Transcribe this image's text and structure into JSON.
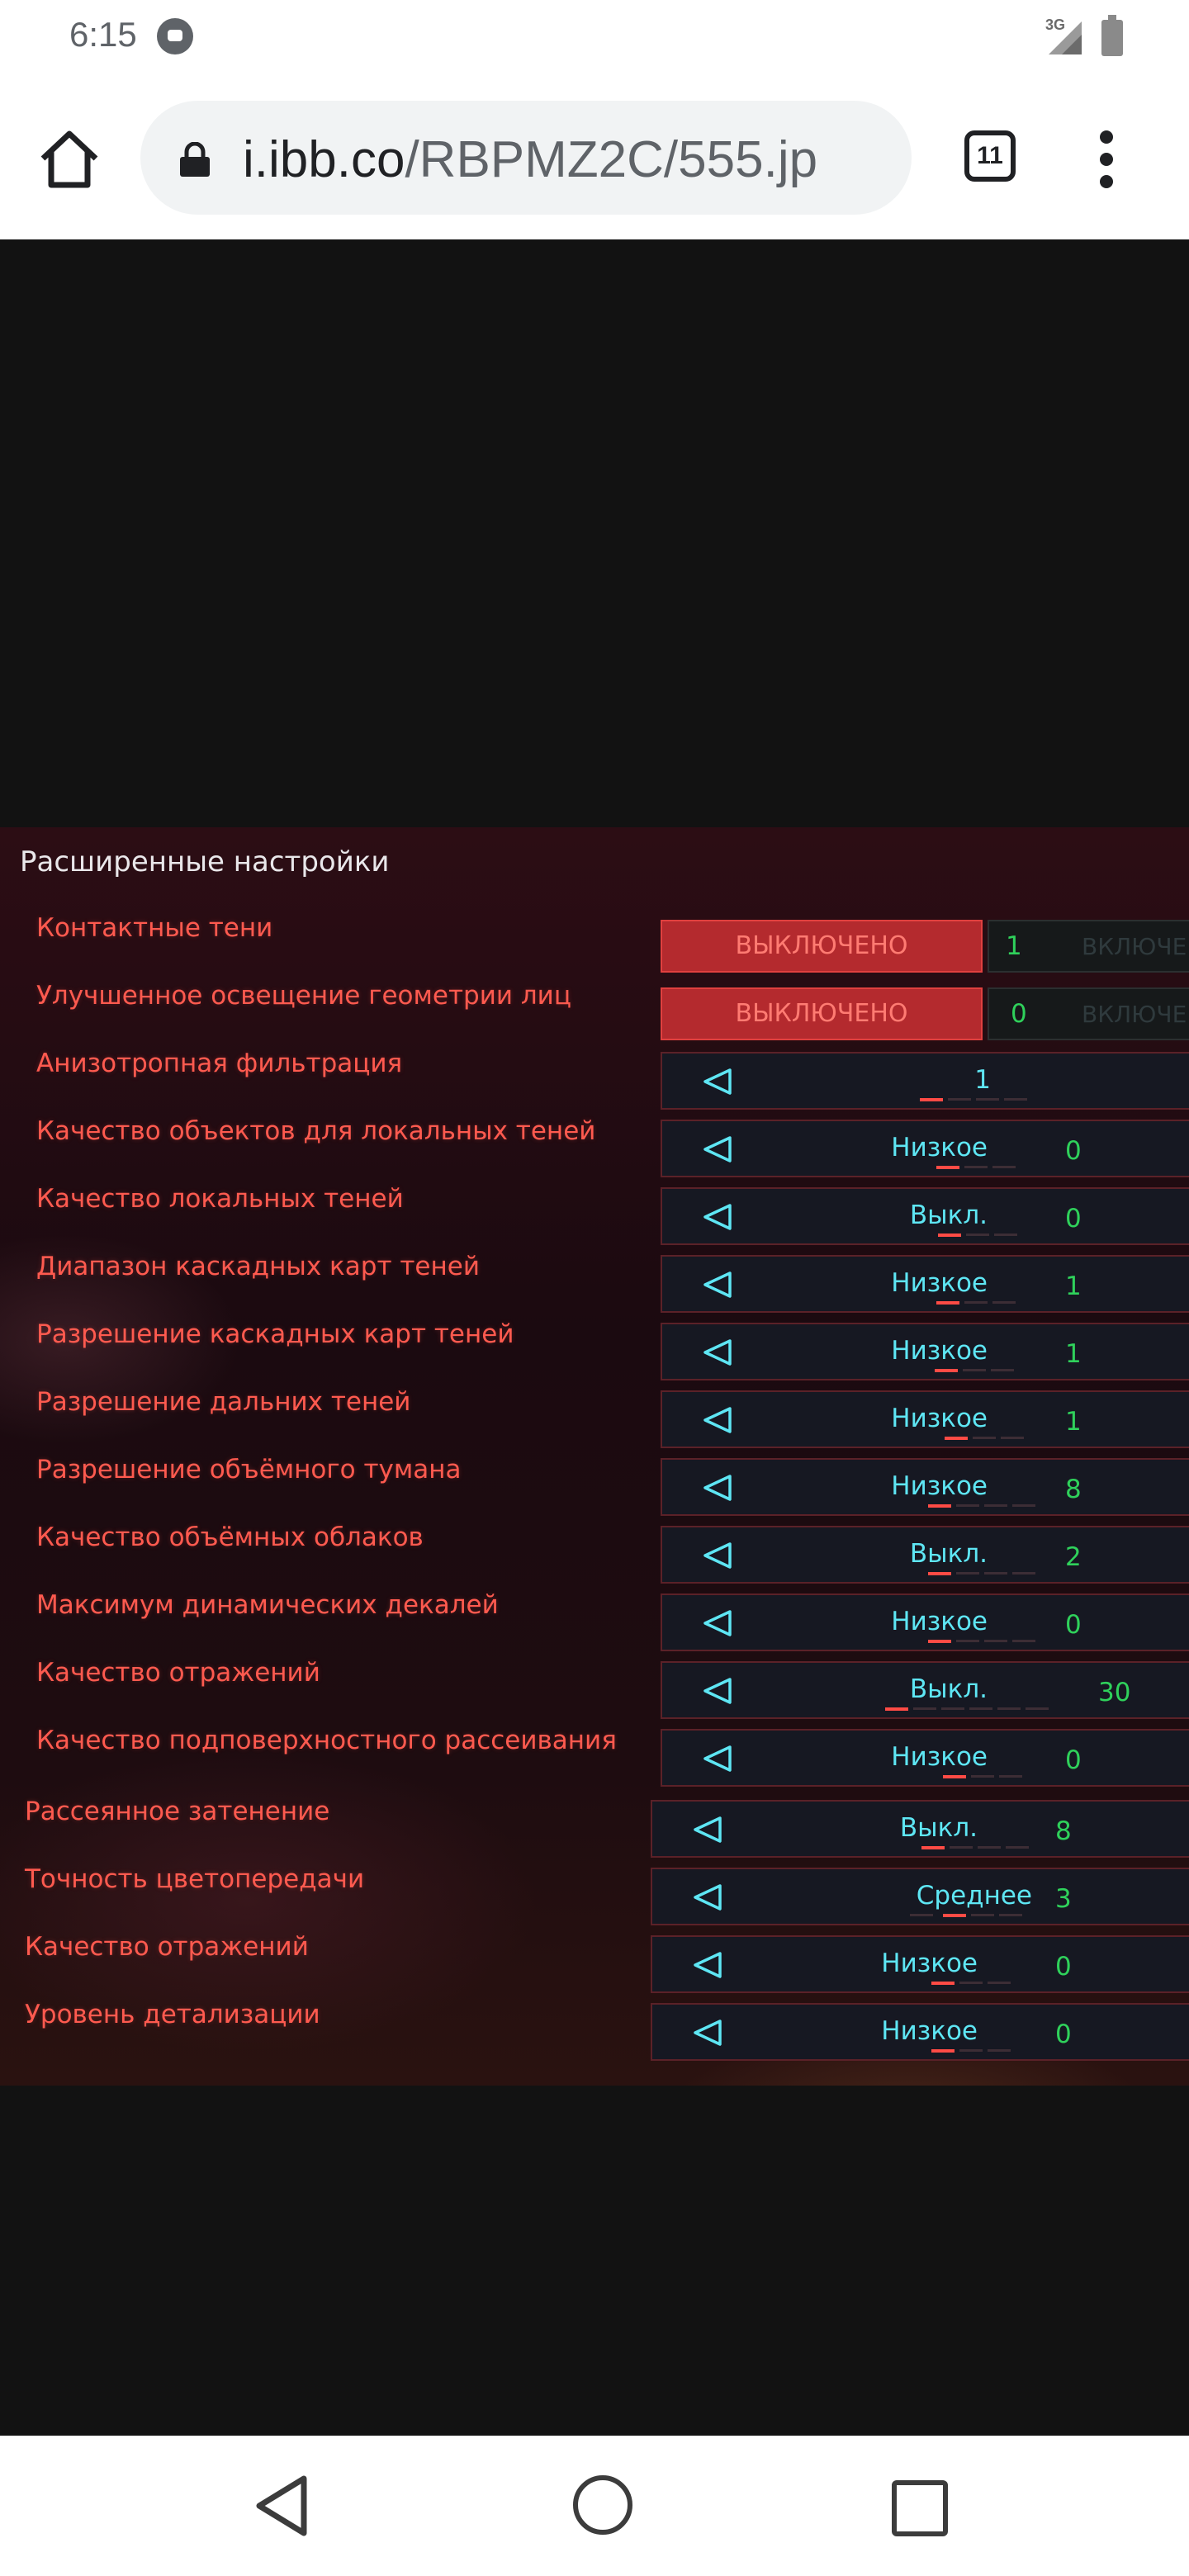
{
  "status_bar": {
    "time": "6:15",
    "network": "3G",
    "icons": [
      "shield-app-icon",
      "signal-icon",
      "battery-icon"
    ]
  },
  "browser": {
    "url_host": "i.ibb.co",
    "url_path": "/RBPMZ2C/555.jp",
    "tab_count": "11",
    "icons": [
      "home-icon",
      "lock-icon",
      "tabs-icon",
      "menu-icon"
    ]
  },
  "settings": {
    "title": "Расширенные настройки",
    "colors": {
      "label": "#ff5a4f",
      "value": "#5ee6f4",
      "number": "#2fd15b",
      "toggle_active": "#b42a2e"
    },
    "toggles": [
      {
        "label": "Контактные тени",
        "state": "ВЫКЛЮЧЕНО",
        "number": "1",
        "alt_state": "ВКЛЮЧЕНО"
      },
      {
        "label": "Улучшенное освещение геометрии лиц",
        "state": "ВЫКЛЮЧЕНО",
        "number": "0",
        "alt_state": "ВКЛЮЧЕНО"
      }
    ],
    "selectors": [
      {
        "label": "Анизотропная фильтрация",
        "value": "1",
        "number": ""
      },
      {
        "label": "Качество объектов для локальных теней",
        "value": "Низкое",
        "number": "0"
      },
      {
        "label": "Качество локальных теней",
        "value": "Выкл.",
        "number": "0"
      },
      {
        "label": "Диапазон каскадных карт теней",
        "value": "Низкое",
        "number": "1"
      },
      {
        "label": "Разрешение каскадных карт теней",
        "value": "Низкое",
        "number": "1"
      },
      {
        "label": "Разрешение дальних теней",
        "value": "Низкое",
        "number": "1"
      },
      {
        "label": "Разрешение объёмного тумана",
        "value": "Низкое",
        "number": "8"
      },
      {
        "label": "Качество объёмных облаков",
        "value": "Выкл.",
        "number": "2"
      },
      {
        "label": "Максимум динамических декалей",
        "value": "Низкое",
        "number": "0"
      },
      {
        "label": "Качество отражений",
        "value": "Выкл.",
        "number": "30"
      },
      {
        "label": "Качество подповерхностного рассеивания",
        "value": "Низкое",
        "number": "0"
      },
      {
        "label": "Рассеянное затенение",
        "value": "Выкл.",
        "number": "8"
      },
      {
        "label": "Точность цветопередачи",
        "value": "Среднее",
        "number": "3"
      },
      {
        "label": "Качество отражений",
        "value": "Низкое",
        "number": "0"
      },
      {
        "label": "Уровень детализации",
        "value": "Низкое",
        "number": "0"
      }
    ]
  },
  "nav_bar": {
    "icons": [
      "back-icon",
      "home-circle-icon",
      "recents-icon"
    ]
  }
}
